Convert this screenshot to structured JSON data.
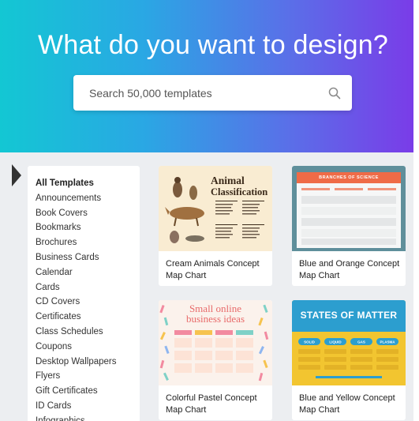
{
  "hero": {
    "title": "What do you want to design?",
    "search_placeholder": "Search 50,000 templates"
  },
  "sidebar": {
    "items": [
      {
        "label": "All Templates"
      },
      {
        "label": "Announcements"
      },
      {
        "label": "Book Covers"
      },
      {
        "label": "Bookmarks"
      },
      {
        "label": "Brochures"
      },
      {
        "label": "Business Cards"
      },
      {
        "label": "Calendar"
      },
      {
        "label": "Cards"
      },
      {
        "label": "CD Covers"
      },
      {
        "label": "Certificates"
      },
      {
        "label": "Class Schedules"
      },
      {
        "label": "Coupons"
      },
      {
        "label": "Desktop Wallpapers"
      },
      {
        "label": "Flyers"
      },
      {
        "label": "Gift Certificates"
      },
      {
        "label": "ID Cards"
      },
      {
        "label": "Infographics"
      }
    ]
  },
  "templates": [
    {
      "label": "Cream Animals Concept Map Chart",
      "thumb_title_1": "Animal",
      "thumb_title_2": "Classification",
      "colors": {
        "bg": "#f9ecd2",
        "ink": "#3b2a1a"
      }
    },
    {
      "label": "Blue and Orange Concept Map Chart",
      "thumb_header": "BRANCHES OF SCIENCE",
      "colors": {
        "bg": "#5f8f9b",
        "accent": "#ef6b47"
      }
    },
    {
      "label": "Colorful Pastel Concept Map Chart",
      "thumb_title_1": "Small online",
      "thumb_title_2": "business ideas",
      "colors": {
        "bg": "#fbf2ec",
        "accent": "#e86b6b"
      }
    },
    {
      "label": "Blue and Yellow Concept Map Chart",
      "thumb_header": "STATES OF MATTER",
      "thumb_pills": [
        "SOLID",
        "LIQUID",
        "GAS",
        "PLASMA"
      ],
      "colors": {
        "top": "#2c9ecf",
        "bg": "#f2c530"
      }
    }
  ],
  "colors": {
    "hero_start": "#13c7d3",
    "hero_end": "#7a3ce8",
    "page_bg": "#eceef1"
  }
}
